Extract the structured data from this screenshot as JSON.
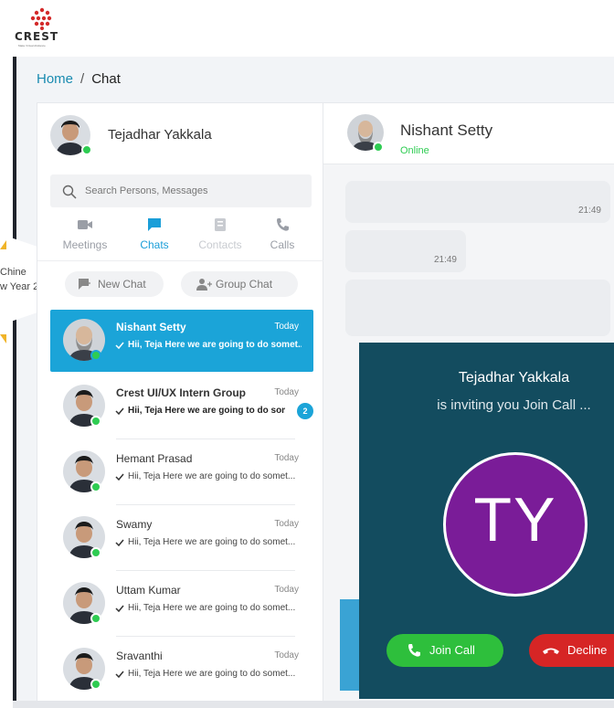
{
  "header": {
    "logo_text": "CREST",
    "logo_tagline": "Make Virtual Abidance"
  },
  "background": {
    "peek_line1": "Chine",
    "peek_line2": "w Year 2"
  },
  "breadcrumb": {
    "home": "Home",
    "separator": "/",
    "current": "Chat"
  },
  "user": {
    "name": "Tejadhar Yakkala",
    "status": "online"
  },
  "search": {
    "placeholder": "Search Persons, Messages"
  },
  "tabs": [
    {
      "label": "Meetings",
      "icon": "video-camera-icon",
      "state": "normal"
    },
    {
      "label": "Chats",
      "icon": "chat-bubble-icon",
      "state": "active"
    },
    {
      "label": "Contacts",
      "icon": "contacts-icon",
      "state": "disabled"
    },
    {
      "label": "Calls",
      "icon": "phone-icon",
      "state": "normal"
    }
  ],
  "actions": {
    "new_chat": "New Chat",
    "group_chat": "Group Chat"
  },
  "chats": [
    {
      "name": "Nishant Setty",
      "time": "Today",
      "message": "Hii, Teja Here we are going to do somet...",
      "unread": null,
      "bold": true,
      "active": true
    },
    {
      "name": "Crest UI/UX Intern Group",
      "time": "Today",
      "message": "Hii, Teja Here we are going to do somet...",
      "unread": "2",
      "bold": true,
      "active": false
    },
    {
      "name": "Hemant Prasad",
      "time": "Today",
      "message": "Hii, Teja Here we are going to do somet...",
      "unread": null,
      "bold": false,
      "active": false
    },
    {
      "name": "Swamy",
      "time": "Today",
      "message": "Hii, Teja Here we are going to do somet...",
      "unread": null,
      "bold": false,
      "active": false
    },
    {
      "name": "Uttam Kumar",
      "time": "Today",
      "message": "Hii, Teja Here we are going to do somet...",
      "unread": null,
      "bold": false,
      "active": false
    },
    {
      "name": "Sravanthi",
      "time": "Today",
      "message": "Hii, Teja Here we are going to do somet...",
      "unread": null,
      "bold": false,
      "active": false
    }
  ],
  "conversation": {
    "name": "Nishant Setty",
    "status": "Online",
    "messages": [
      {
        "time": "21:49"
      },
      {
        "time": "21:49"
      }
    ]
  },
  "incoming_call": {
    "caller": "Tejadhar Yakkala",
    "subtitle": "is inviting you Join Call ...",
    "initials": "TY",
    "avatar_color": "#7a1c98",
    "join_label": "Join Call",
    "decline_label": "Decline"
  },
  "colors": {
    "accent": "#1ba4d8",
    "online": "#2ecc52",
    "call_bg": "#134c5f",
    "join": "#2ebf3c",
    "decline": "#d62525"
  }
}
